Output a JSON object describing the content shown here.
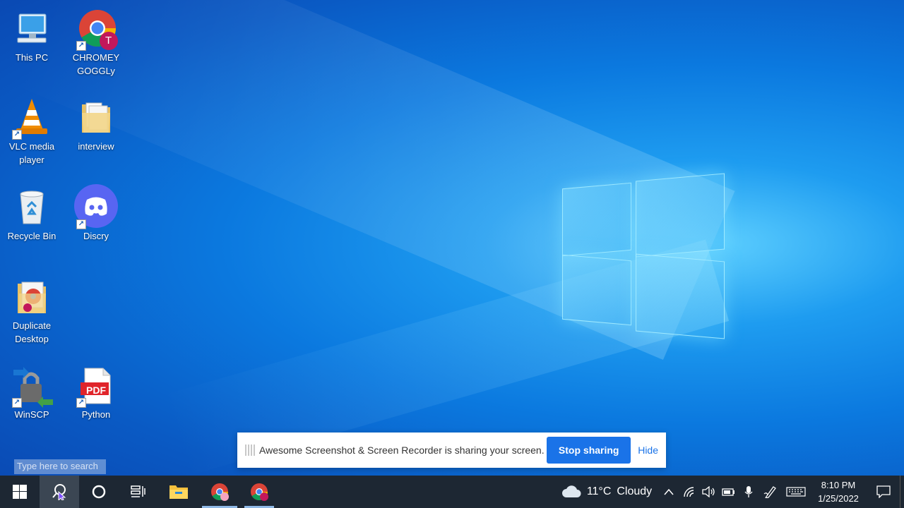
{
  "desktop": {
    "icons": [
      {
        "label": "This PC"
      },
      {
        "label": "CHROMEY GOGGLy"
      },
      {
        "label": "VLC media player"
      },
      {
        "label": "interview"
      },
      {
        "label": "Recycle Bin"
      },
      {
        "label": "Discry"
      },
      {
        "label": "Duplicate Desktop"
      },
      {
        "label": "WinSCP"
      },
      {
        "label": "Python"
      }
    ],
    "chrome_badge": "T",
    "pdf_text": "PDF"
  },
  "share_bar": {
    "message": "Awesome Screenshot & Screen Recorder is sharing your screen.",
    "stop_label": "Stop sharing",
    "hide_label": "Hide"
  },
  "search": {
    "placeholder": "Type here to search"
  },
  "taskbar": {
    "weather": {
      "temp": "11°C",
      "condition": "Cloudy"
    },
    "clock": {
      "time": "8:10 PM",
      "date": "1/25/2022"
    }
  },
  "colors": {
    "taskbar_bg": "#1d2733",
    "accent": "#1a73e8"
  }
}
